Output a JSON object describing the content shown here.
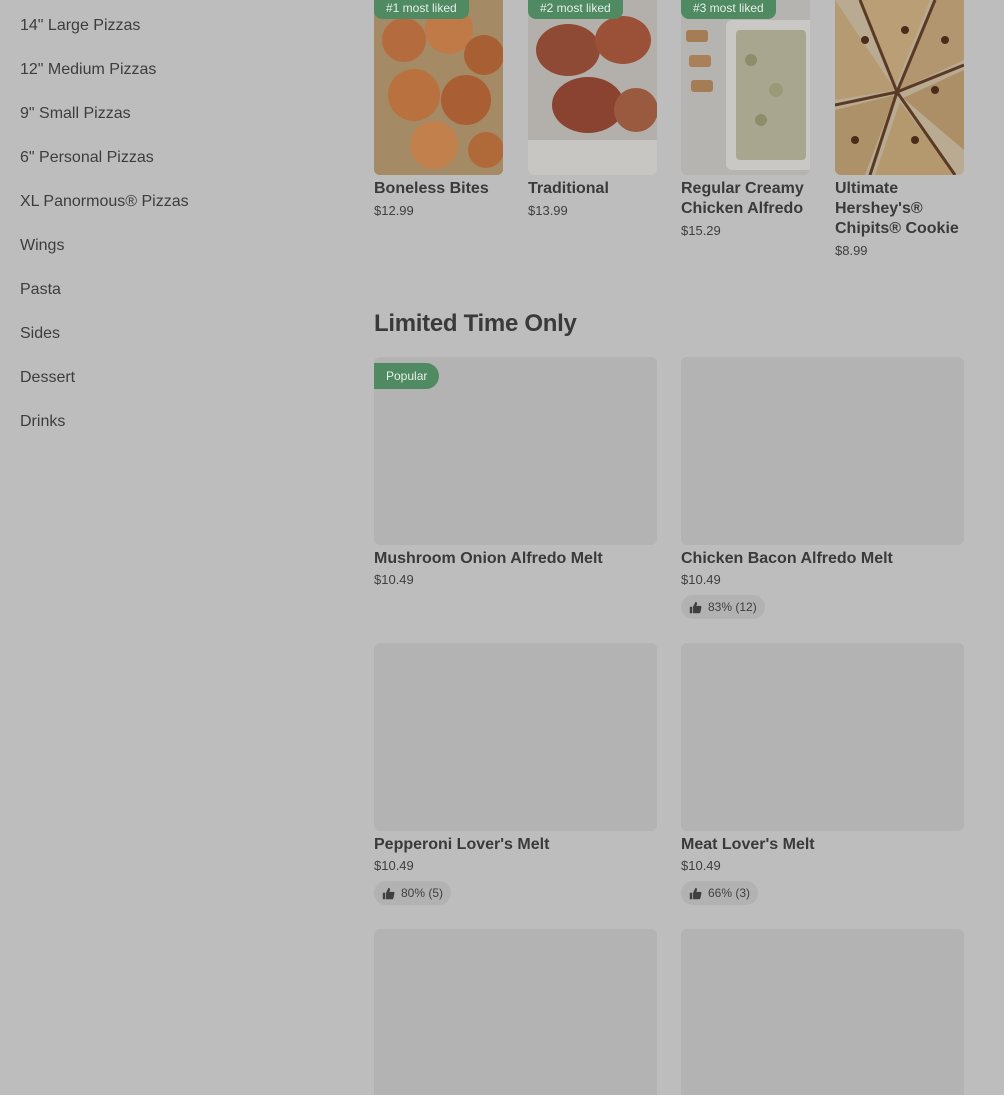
{
  "sidebar": {
    "items": [
      {
        "label": "14\" Large Pizzas"
      },
      {
        "label": "12\" Medium Pizzas"
      },
      {
        "label": "9\" Small Pizzas"
      },
      {
        "label": "6\" Personal Pizzas"
      },
      {
        "label": "XL Panormous® Pizzas"
      },
      {
        "label": "Wings"
      },
      {
        "label": "Pasta"
      },
      {
        "label": "Sides"
      },
      {
        "label": "Dessert"
      },
      {
        "label": "Drinks"
      }
    ]
  },
  "most_liked": [
    {
      "badge": "#1 most liked",
      "name": "Boneless Bites",
      "price": "$12.99",
      "image": "boneless-bites-photo"
    },
    {
      "badge": "#2 most liked",
      "name": "Traditional",
      "price": "$13.99",
      "image": "traditional-wings-photo"
    },
    {
      "badge": "#3 most liked",
      "name": "Regular Creamy Chicken Alfredo",
      "price": "$15.29",
      "image": "chicken-alfredo-photo"
    },
    {
      "badge": "",
      "name": "Ultimate Hershey's® Chipits® Cookie",
      "price": "$8.99",
      "image": "chipits-cookie-photo"
    }
  ],
  "limited_section": {
    "title": "Limited Time Only",
    "items": [
      {
        "badge": "Popular",
        "name": "Mushroom Onion Alfredo Melt",
        "price": "$10.49",
        "rating": ""
      },
      {
        "badge": "",
        "name": "Chicken Bacon Alfredo Melt",
        "price": "$10.49",
        "rating": "83% (12)"
      },
      {
        "badge": "",
        "name": "Pepperoni Lover's Melt",
        "price": "$10.49",
        "rating": "80% (5)"
      },
      {
        "badge": "",
        "name": "Meat Lover's Melt",
        "price": "$10.49",
        "rating": "66% (3)"
      },
      {
        "badge": "",
        "name": "",
        "price": "",
        "rating": ""
      },
      {
        "badge": "",
        "name": "",
        "price": "",
        "rating": ""
      }
    ]
  },
  "icons": {
    "rating": "thumbs-up-icon"
  },
  "colors": {
    "badge": "#4f8a62",
    "background": "#bdbdbd",
    "placeholder": "#b3b3b3"
  }
}
